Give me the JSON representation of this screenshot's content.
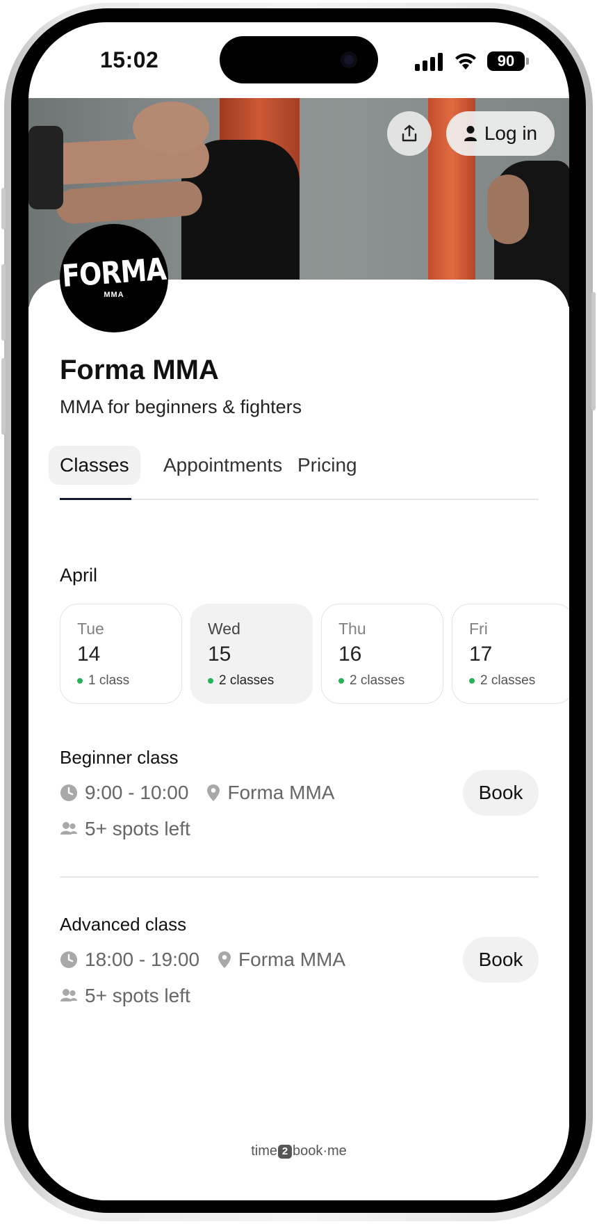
{
  "status_bar": {
    "time": "15:02",
    "battery": "90"
  },
  "header": {
    "login_label": "Log in"
  },
  "business": {
    "logo_text": "FORMA",
    "logo_sub": "MMA",
    "name": "Forma MMA",
    "description": "MMA for beginners & fighters"
  },
  "tabs": [
    {
      "label": "Classes",
      "active": true
    },
    {
      "label": "Appointments",
      "active": false
    },
    {
      "label": "Pricing",
      "active": false
    }
  ],
  "calendar": {
    "month": "April",
    "days": [
      {
        "weekday": "Tue",
        "date": "14",
        "count": "1 class",
        "selected": false
      },
      {
        "weekday": "Wed",
        "date": "15",
        "count": "2 classes",
        "selected": true
      },
      {
        "weekday": "Thu",
        "date": "16",
        "count": "2 classes",
        "selected": false
      },
      {
        "weekday": "Fri",
        "date": "17",
        "count": "2 classes",
        "selected": false
      }
    ]
  },
  "classes": [
    {
      "title": "Beginner class",
      "time": "9:00 - 10:00",
      "location": "Forma MMA",
      "spots": "5+ spots left",
      "book_label": "Book"
    },
    {
      "title": "Advanced class",
      "time": "18:00 - 19:00",
      "location": "Forma MMA",
      "spots": "5+ spots left",
      "book_label": "Book"
    }
  ],
  "footer": {
    "brand_pre": "time",
    "brand_num": "2",
    "brand_post": "book·me"
  },
  "colors": {
    "accent": "#141a2e",
    "available_dot": "#26b35a",
    "button_bg": "#f1f1f1"
  }
}
